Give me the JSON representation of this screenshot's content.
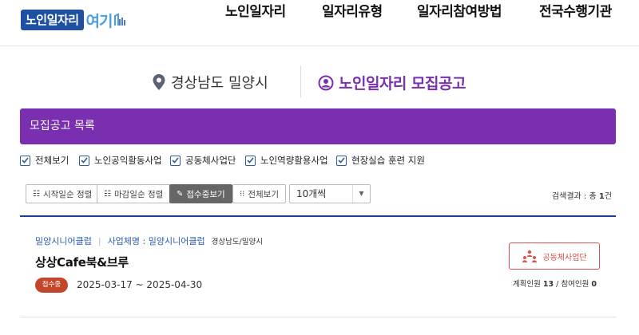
{
  "header": {
    "logo_main": "노인일자리",
    "logo_sub": "여기",
    "nav": [
      "노인일자리",
      "일자리유형",
      "일자리참여방법",
      "전국수행기관"
    ]
  },
  "location": {
    "region": "경상남도 밀양시",
    "section_title": "노인일자리 모집공고"
  },
  "list_title": "모집공고 목록",
  "filters": [
    {
      "label": "전체보기",
      "checked": true
    },
    {
      "label": "노인공익활동사업",
      "checked": true
    },
    {
      "label": "공동체사업단",
      "checked": true
    },
    {
      "label": "노인역량활용사업",
      "checked": true
    },
    {
      "label": "현장실습 훈련 지원",
      "checked": true
    }
  ],
  "sort_buttons": [
    {
      "label": "시작일순 정렬",
      "icon": "list-icon",
      "active": false
    },
    {
      "label": "마감일순 정렬",
      "icon": "list-icon",
      "active": false
    },
    {
      "label": "접수중보기",
      "icon": "pencil-icon",
      "active": true
    },
    {
      "label": "전체보기",
      "icon": "grid-icon",
      "active": false
    }
  ],
  "page_size": {
    "selected": "10개씩"
  },
  "result": {
    "prefix": "검색결과 : 총 ",
    "count": "1",
    "suffix": "건"
  },
  "listing": {
    "org": "밀양시니어클럽",
    "business_label": "사업체명 : 밀양시니어클럽",
    "region": "경상남도/밀양시",
    "title": "상상Cafe북&브루",
    "status": "접수중",
    "period": "2025-03-17 ~ 2025-04-30",
    "type": "공동체사업단",
    "planned_label": "계획인원 ",
    "planned": "13",
    "sep": " / ",
    "joined_label": "참여인원 ",
    "joined": "0"
  },
  "colors": {
    "brand_blue": "#1e4fa0",
    "purple": "#7a2fb0",
    "status_red": "#c4462a",
    "type_red": "#d9534f"
  }
}
